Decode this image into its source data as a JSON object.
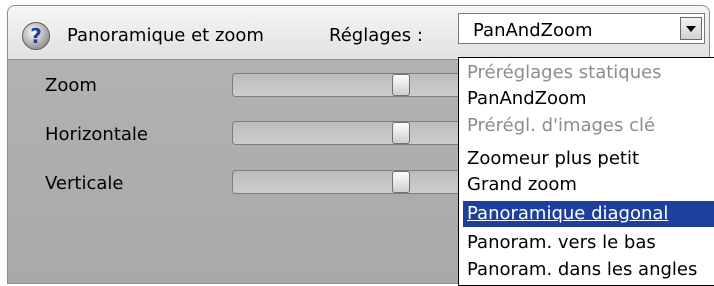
{
  "title": "Panoramique et zoom",
  "presets_label": "Réglages :",
  "combo": {
    "value": "PanAndZoom"
  },
  "sliders": [
    {
      "label": "Zoom",
      "position": 0.5
    },
    {
      "label": "Horizontale",
      "position": 0.5
    },
    {
      "label": "Verticale",
      "position": 0.5
    }
  ],
  "dropdown": {
    "items": [
      {
        "label": "Préréglages statiques",
        "kind": "header"
      },
      {
        "label": "PanAndZoom",
        "kind": "option"
      },
      {
        "label": "Prérégl. d'images clé",
        "kind": "header"
      },
      {
        "label": "Zoomeur plus petit",
        "kind": "option"
      },
      {
        "label": "Grand zoom",
        "kind": "option"
      },
      {
        "label": "Panoramique diagonal",
        "kind": "selected"
      },
      {
        "label": "Panoram. vers le bas",
        "kind": "option"
      },
      {
        "label": "Panoram. dans les angles",
        "kind": "option"
      }
    ]
  },
  "icons": {
    "help": "help-icon",
    "combo_arrow": "chevron-down-icon"
  },
  "colors": {
    "highlight": "#1f3f9c",
    "header_text": "#8c8c8c",
    "panel": "#acacac"
  }
}
